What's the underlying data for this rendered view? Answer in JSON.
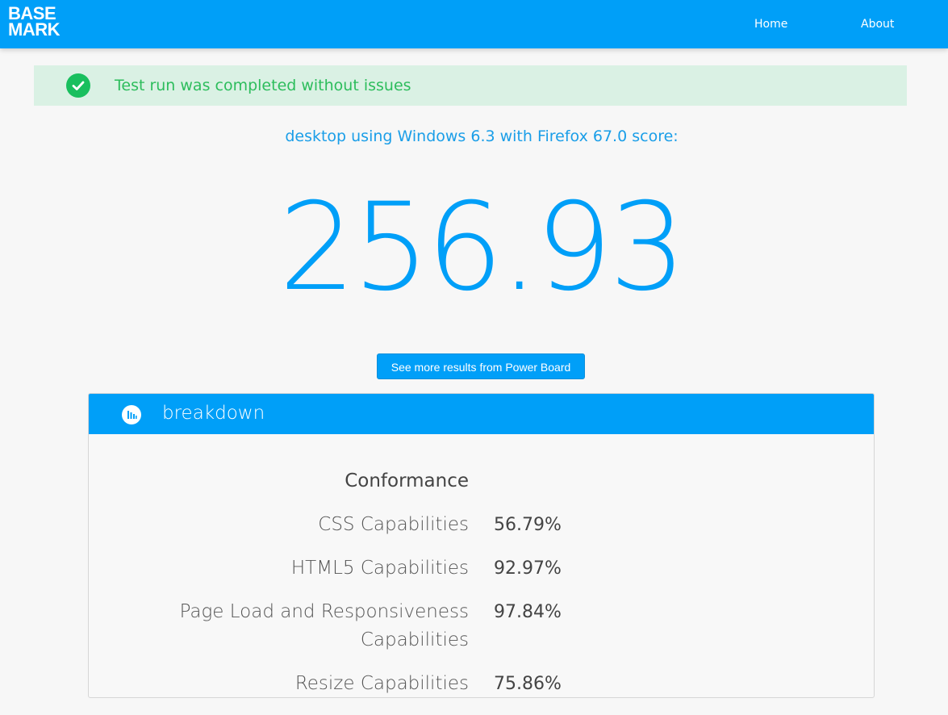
{
  "header": {
    "logo_line1": "BASE",
    "logo_line2": "MARK",
    "nav": [
      {
        "label": "Home"
      },
      {
        "label": "About"
      }
    ]
  },
  "alert": {
    "icon": "check-circle-icon",
    "message": "Test run was completed without issues",
    "color": "#2dbd5c"
  },
  "result": {
    "subtitle": "desktop using Windows 6.3 with Firefox 67.0 score:",
    "score": "256.93",
    "power_board_button": "See more results from Power Board"
  },
  "breakdown": {
    "icon": "bar-chart-icon",
    "title": "breakdown",
    "section": "Conformance",
    "rows": [
      {
        "label_lines": [
          "CSS Capabilities"
        ],
        "value": "56.79%"
      },
      {
        "label_lines": [
          "HTML5 Capabilities"
        ],
        "value": "92.97%"
      },
      {
        "label_lines": [
          "Page Load and Responsiveness",
          "Capabilities"
        ],
        "value": "97.84%"
      },
      {
        "label_lines": [
          "Resize Capabilities"
        ],
        "value": "75.86%"
      }
    ]
  },
  "colors": {
    "brand_blue": "#009ff8",
    "alert_bg": "#daf1e4",
    "page_bg": "#f7f7f7"
  }
}
